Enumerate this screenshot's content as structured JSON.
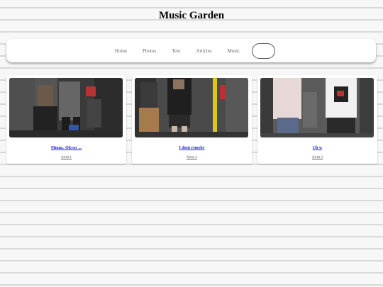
{
  "site": {
    "title": "Music Garden"
  },
  "nav": {
    "items": [
      "Home",
      "Photos",
      "Text",
      "Articles",
      "Music"
    ],
    "search_icon": "pill-search-button"
  },
  "cards": [
    {
      "title": "Mmm.. Okyay ...",
      "artist": "Artist 1"
    },
    {
      "title": "I dont remebr",
      "artist": "Artist 2"
    },
    {
      "title": "Uh w",
      "artist": "Artist 3"
    }
  ]
}
